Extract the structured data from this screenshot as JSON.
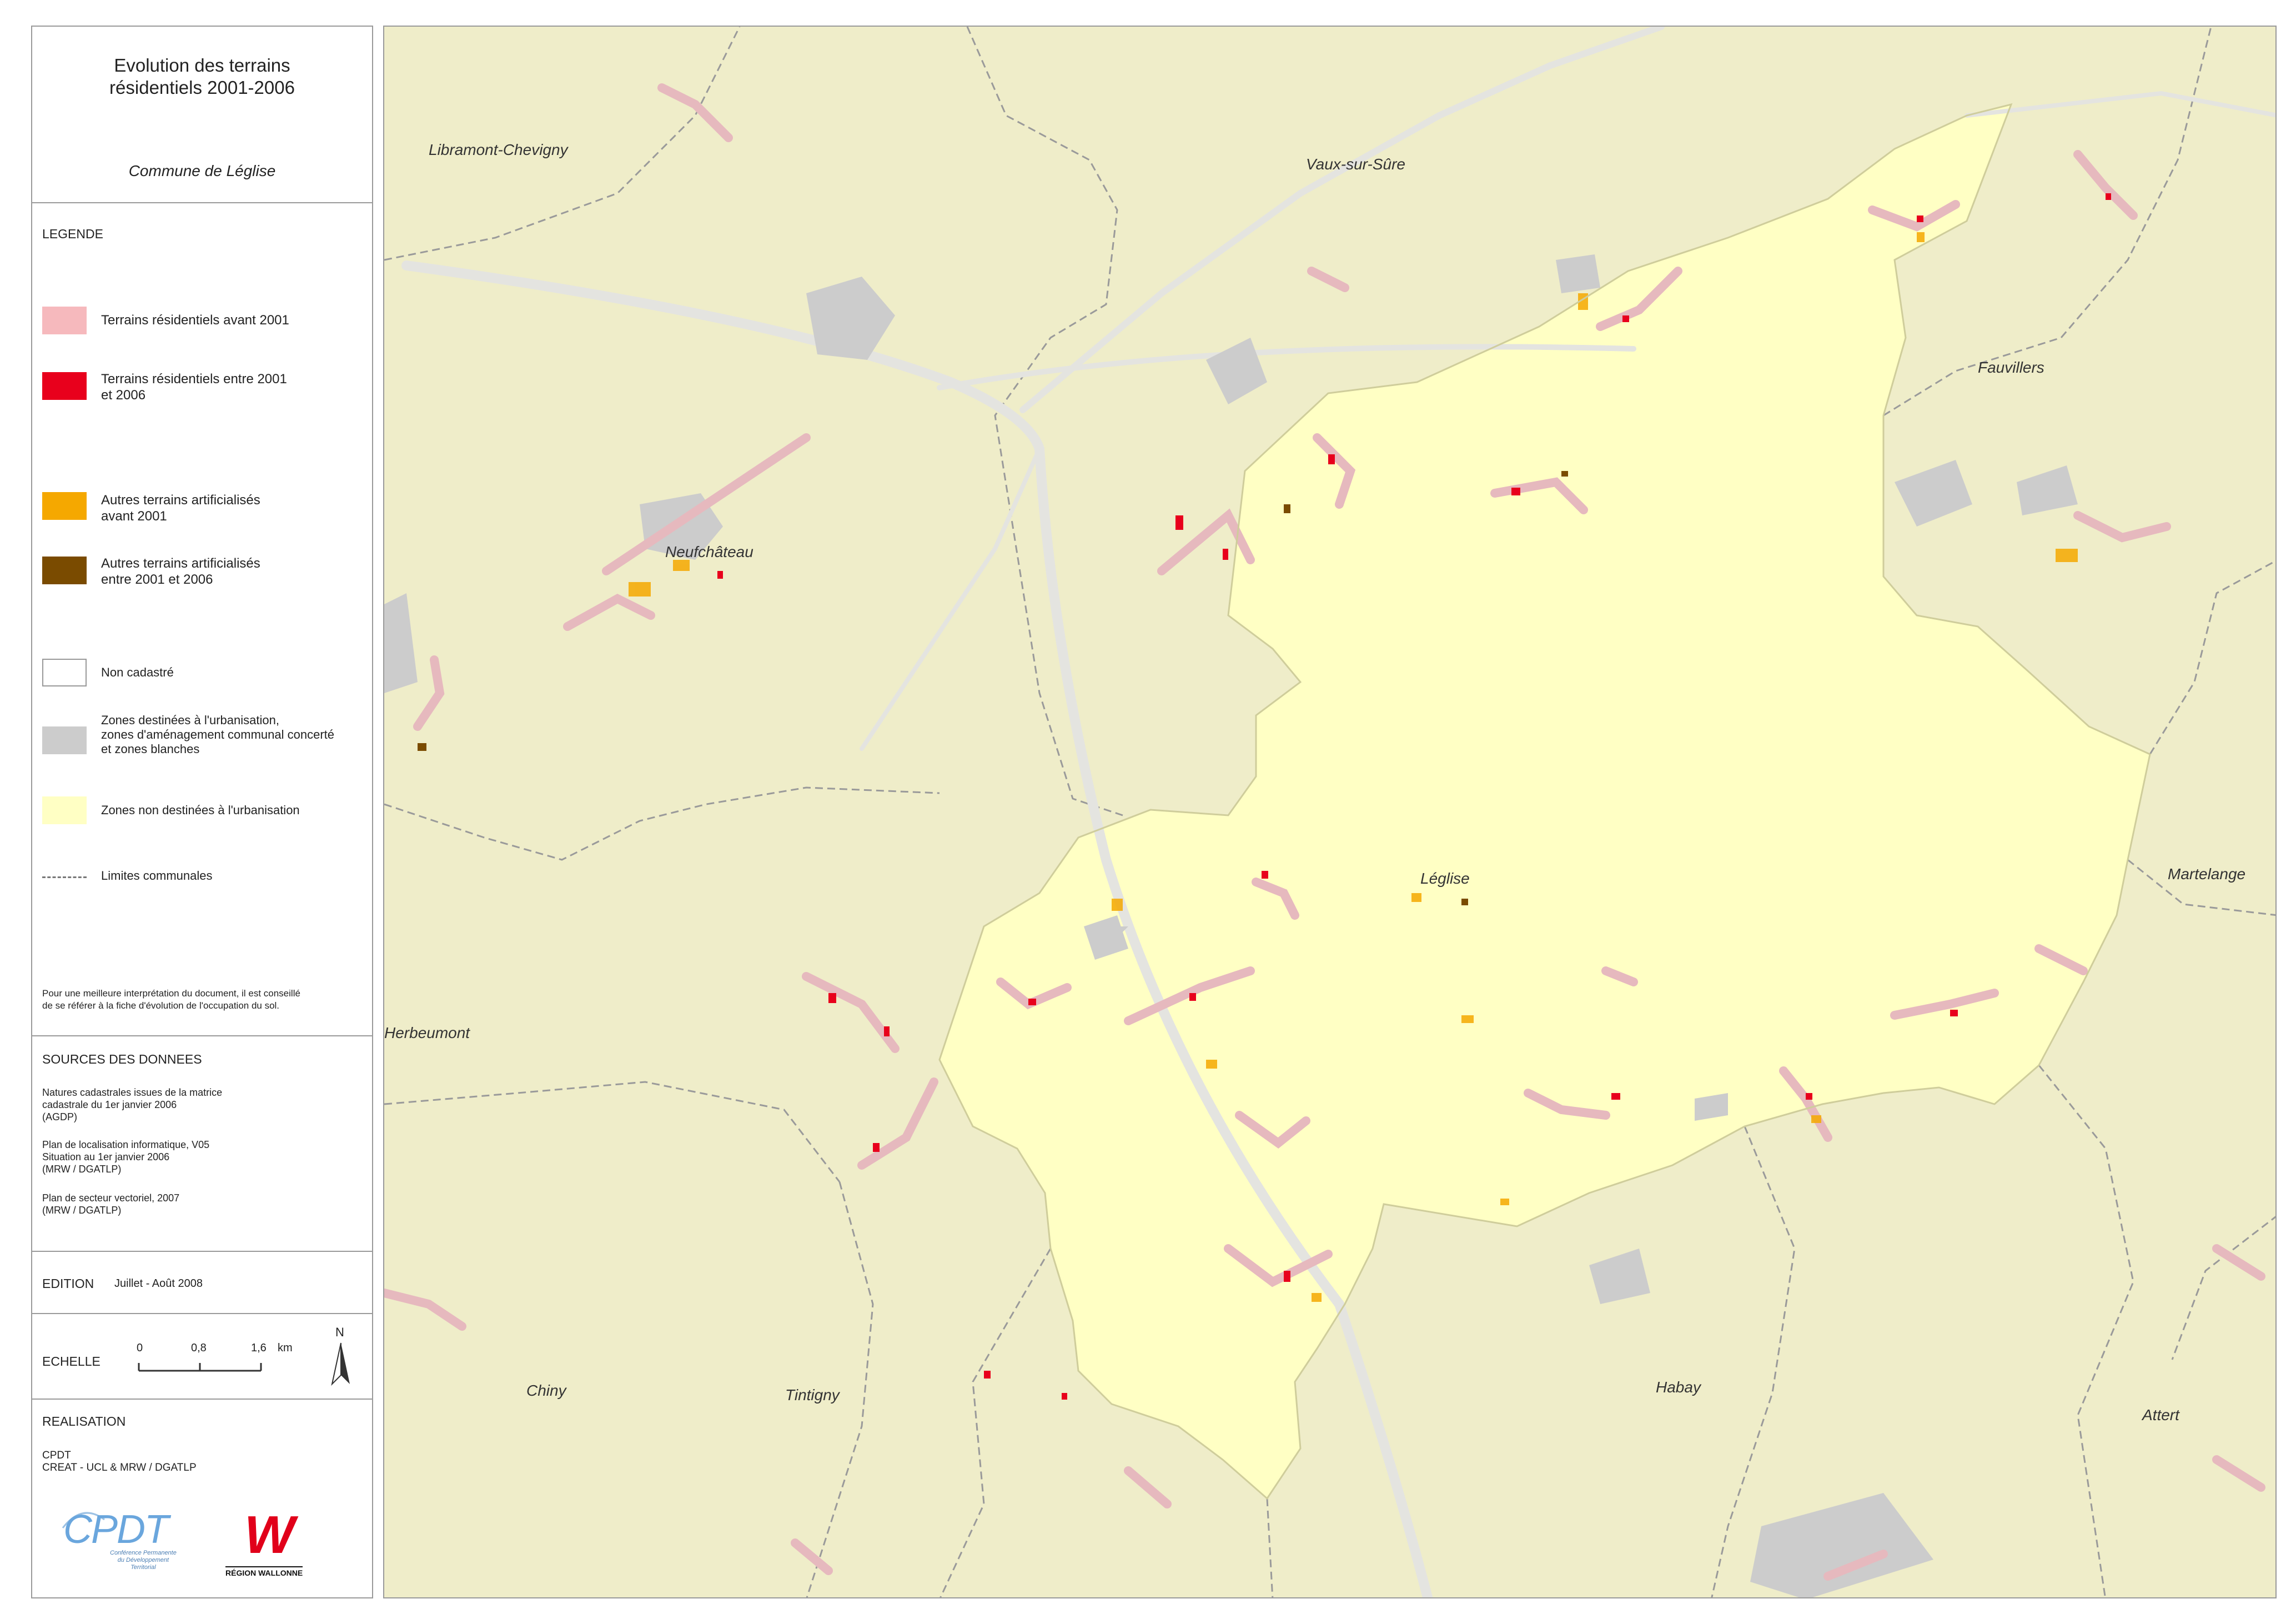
{
  "title": {
    "main": "Evolution des terrains\nrésidentiels 2001-2006",
    "subtitle": "Commune de Léglise"
  },
  "legend": {
    "heading": "LEGENDE",
    "items": [
      {
        "label": "Terrains résidentiels avant 2001",
        "color": "#f6b9bd",
        "icon": "pink-swatch"
      },
      {
        "label": "Terrains résidentiels entre 2001\net 2006",
        "color": "#e8001c",
        "icon": "red-swatch"
      },
      {
        "label": "Autres terrains artificialisés\navant 2001",
        "color": "#f5a800",
        "icon": "orange-swatch"
      },
      {
        "label": "Autres terrains artificialisés\nentre 2001 et 2006",
        "color": "#7a4b00",
        "icon": "brown-swatch"
      },
      {
        "label": "Non cadastré",
        "color": "#ffffff",
        "icon": "white-swatch"
      },
      {
        "label": "Zones destinées à l'urbanisation,\nzones d'aménagement communal concerté\net zones blanches",
        "color": "#cccccc",
        "icon": "grey-swatch"
      },
      {
        "label": "Zones non destinées à l'urbanisation",
        "color": "#ffffc4",
        "icon": "yellow-swatch"
      },
      {
        "label": "Limites communales",
        "color": "#777777",
        "icon": "dashed-line"
      }
    ],
    "note": "Pour une meilleure interprétation du document, il est conseillé\nde se référer à la fiche d'évolution de l'occupation du sol."
  },
  "sources": {
    "heading": "SOURCES DES DONNEES",
    "entries": [
      "Natures cadastrales issues de la matrice\ncadastrale du 1er janvier 2006\n(AGDP)",
      "Plan de localisation informatique, V05\nSituation au 1er janvier 2006\n(MRW / DGATLP)",
      "Plan de secteur vectoriel, 2007\n(MRW / DGATLP)"
    ]
  },
  "edition": {
    "label": "EDITION",
    "value": "Juillet - Août 2008"
  },
  "scale": {
    "label": "ECHELLE",
    "ticks": [
      "0",
      "0,8",
      "1,6"
    ],
    "unit": "km",
    "north": "N"
  },
  "realisation": {
    "heading": "REALISATION",
    "lines": "CPDT\nCREAT - UCL & MRW / DGATLP",
    "logo_cpdt": {
      "text": "CPDT",
      "tagline": "Conférence Permanente\ndu Développement\nTerritorial"
    },
    "logo_region": {
      "mark": "W",
      "text": "RÉGION WALLONNE"
    }
  },
  "map": {
    "colors": {
      "background": "#efedc9",
      "commune": "#ffffc4",
      "residential_old": "#f6b9bd",
      "residential_new": "#e8001c",
      "artificial_old": "#f5a800",
      "artificial_new": "#7a4b00",
      "zone": "#cccccc",
      "boundary": "#999999"
    },
    "places": [
      "Libramont-Chevigny",
      "Vaux-sur-Sûre",
      "Fauvillers",
      "Neufchâteau",
      "Léglise",
      "Martelange",
      "Herbeumont",
      "Chiny",
      "Tintigny",
      "Habay",
      "Attert"
    ]
  }
}
